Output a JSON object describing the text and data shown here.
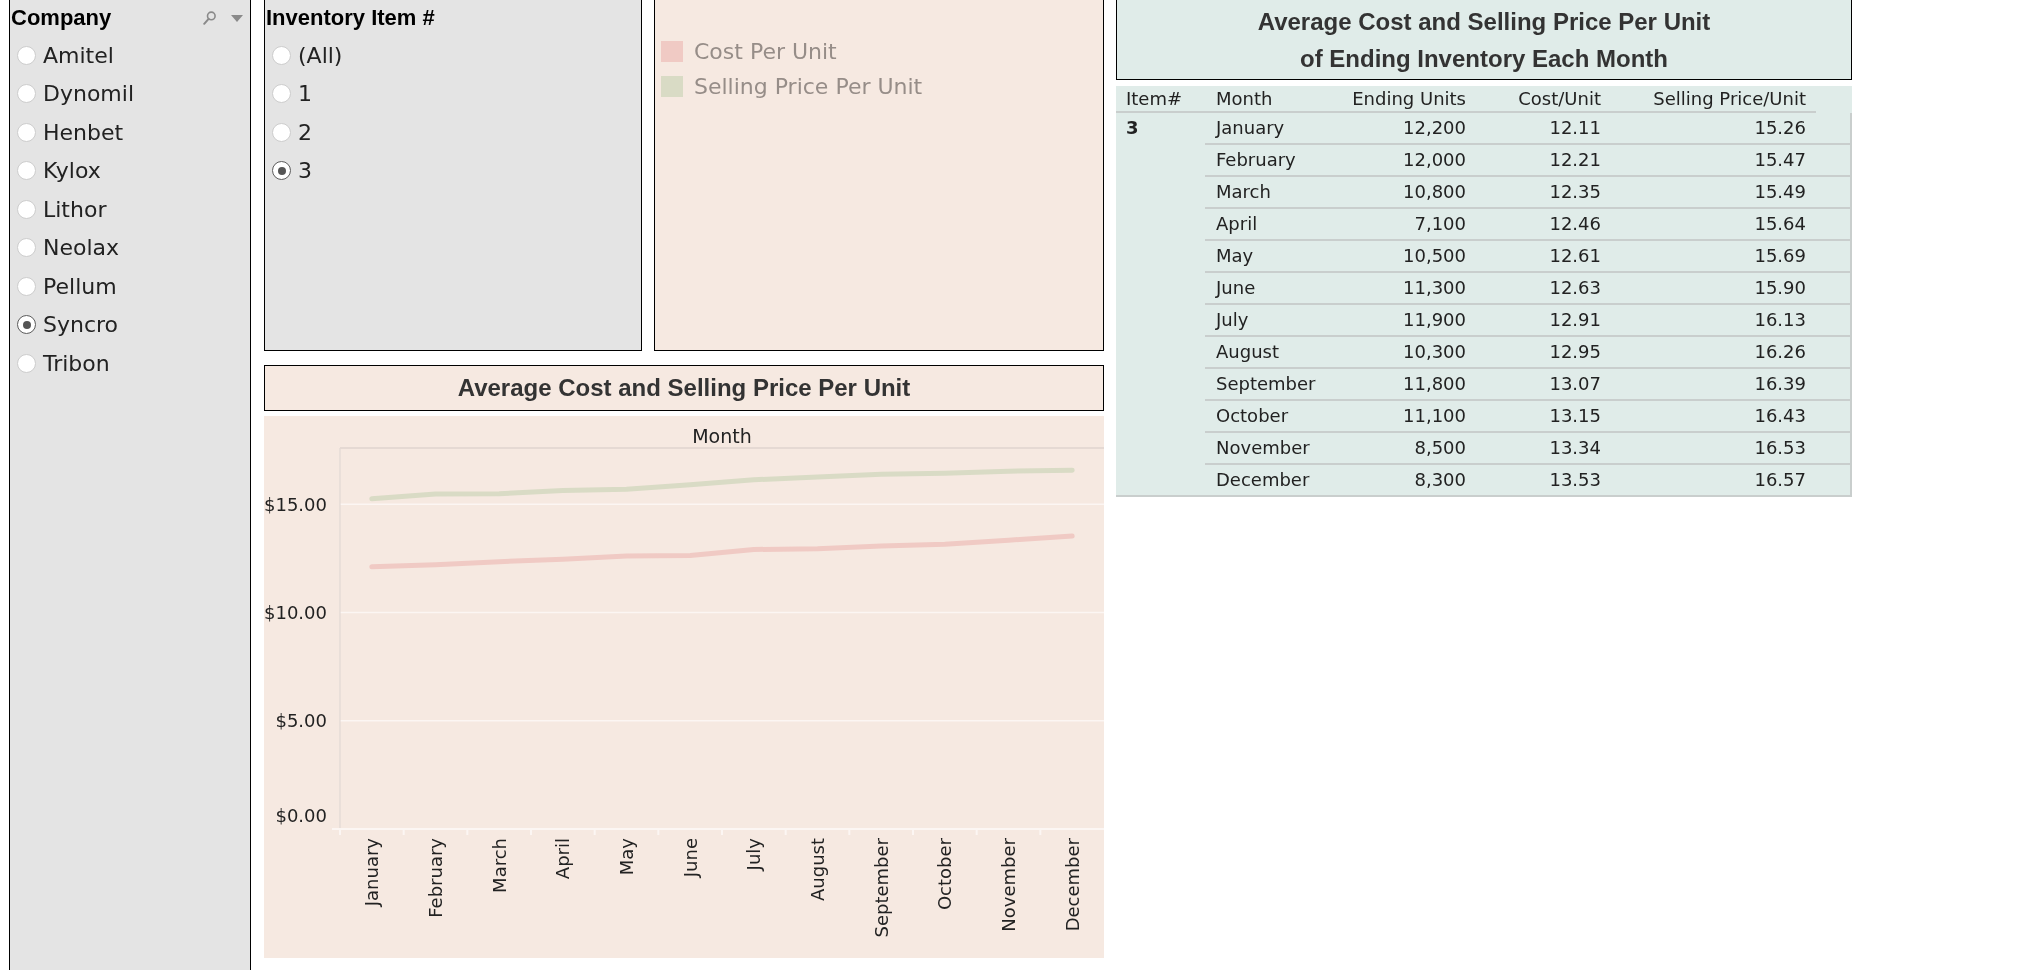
{
  "company_filter": {
    "title": "Company",
    "options": [
      {
        "label": "Amitel",
        "selected": false
      },
      {
        "label": "Dynomil",
        "selected": false
      },
      {
        "label": "Henbet",
        "selected": false
      },
      {
        "label": "Kylox",
        "selected": false
      },
      {
        "label": "Lithor",
        "selected": false
      },
      {
        "label": "Neolax",
        "selected": false
      },
      {
        "label": "Pellum",
        "selected": false
      },
      {
        "label": "Syncro",
        "selected": true
      },
      {
        "label": "Tribon",
        "selected": false
      }
    ]
  },
  "inventory_filter": {
    "title": "Inventory Item #",
    "options": [
      {
        "label": "(All)",
        "selected": false
      },
      {
        "label": "1",
        "selected": false
      },
      {
        "label": "2",
        "selected": false
      },
      {
        "label": "3",
        "selected": true
      }
    ]
  },
  "legend": {
    "items": [
      {
        "label": "Cost Per Unit",
        "color": "#f0cac4"
      },
      {
        "label": "Selling Price Per Unit",
        "color": "#d9dbc5"
      }
    ]
  },
  "line_chart": {
    "title": "Average Cost and Selling Price Per Unit",
    "chart_data": {
      "type": "line",
      "xlabel": "Month",
      "categories": [
        "January",
        "February",
        "March",
        "April",
        "May",
        "June",
        "July",
        "August",
        "September",
        "October",
        "November",
        "December"
      ],
      "series": [
        {
          "color": "#f0cac4",
          "values": [
            12.11,
            12.21,
            12.35,
            12.46,
            12.61,
            12.63,
            12.91,
            12.95,
            13.07,
            13.15,
            13.34,
            13.53
          ]
        },
        {
          "color": "#d9dbc5",
          "values": [
            15.26,
            15.47,
            15.49,
            15.64,
            15.69,
            15.9,
            16.13,
            16.26,
            16.39,
            16.43,
            16.53,
            16.57
          ]
        }
      ],
      "ylim": [
        0,
        17.6
      ],
      "yticks": [
        {
          "value": 0,
          "label": "$0.00"
        },
        {
          "value": 5,
          "label": "$5.00"
        },
        {
          "value": 10,
          "label": "$10.00"
        },
        {
          "value": 15,
          "label": "$15.00"
        }
      ],
      "grid": true
    }
  },
  "table": {
    "title_lines": [
      "Average Cost and Selling Price Per Unit",
      "of Ending Inventory Each Month"
    ],
    "columns": [
      "Item#",
      "Month",
      "Ending Units",
      "Cost/Unit",
      "Selling Price/Unit"
    ],
    "item": "3",
    "rows": [
      {
        "month": "January",
        "ending_units": "12,200",
        "cost_unit": "12.11",
        "selling_price_unit": "15.26"
      },
      {
        "month": "February",
        "ending_units": "12,000",
        "cost_unit": "12.21",
        "selling_price_unit": "15.47"
      },
      {
        "month": "March",
        "ending_units": "10,800",
        "cost_unit": "12.35",
        "selling_price_unit": "15.49"
      },
      {
        "month": "April",
        "ending_units": "7,100",
        "cost_unit": "12.46",
        "selling_price_unit": "15.64"
      },
      {
        "month": "May",
        "ending_units": "10,500",
        "cost_unit": "12.61",
        "selling_price_unit": "15.69"
      },
      {
        "month": "June",
        "ending_units": "11,300",
        "cost_unit": "12.63",
        "selling_price_unit": "15.90"
      },
      {
        "month": "July",
        "ending_units": "11,900",
        "cost_unit": "12.91",
        "selling_price_unit": "16.13"
      },
      {
        "month": "August",
        "ending_units": "10,300",
        "cost_unit": "12.95",
        "selling_price_unit": "16.26"
      },
      {
        "month": "September",
        "ending_units": "11,800",
        "cost_unit": "13.07",
        "selling_price_unit": "16.39"
      },
      {
        "month": "October",
        "ending_units": "11,100",
        "cost_unit": "13.15",
        "selling_price_unit": "16.43"
      },
      {
        "month": "November",
        "ending_units": "8,500",
        "cost_unit": "13.34",
        "selling_price_unit": "16.53"
      },
      {
        "month": "December",
        "ending_units": "8,300",
        "cost_unit": "13.53",
        "selling_price_unit": "16.57"
      }
    ]
  }
}
